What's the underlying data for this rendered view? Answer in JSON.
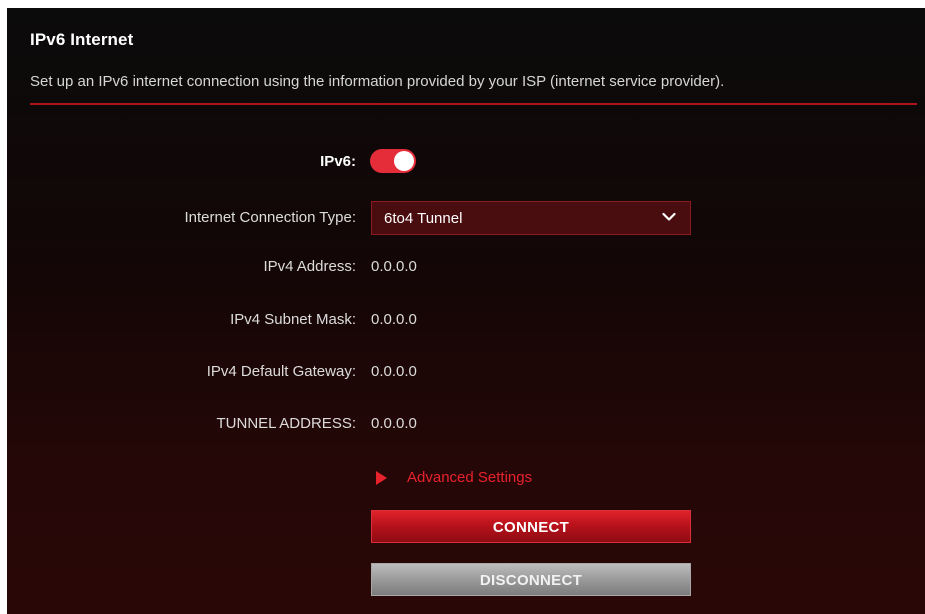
{
  "section": {
    "title": "IPv6 Internet",
    "description": "Set up an IPv6 internet connection using the information provided by your ISP (internet service provider)."
  },
  "colors": {
    "accent": "#e52d3a",
    "divider": "#b1131b",
    "link": "#e8222c"
  },
  "form": {
    "ipv6": {
      "label": "IPv6:",
      "enabled": true
    },
    "connection_type": {
      "label": "Internet Connection Type:",
      "value": "6to4 Tunnel",
      "icon": "chevron-down-icon"
    },
    "ipv4_address": {
      "label": "IPv4 Address:",
      "value": "0.0.0.0"
    },
    "ipv4_subnet_mask": {
      "label": "IPv4 Subnet Mask:",
      "value": "0.0.0.0"
    },
    "ipv4_default_gateway": {
      "label": "IPv4 Default Gateway:",
      "value": "0.0.0.0"
    },
    "tunnel_address": {
      "label": "TUNNEL ADDRESS:",
      "value": "0.0.0.0"
    }
  },
  "advanced": {
    "label": "Advanced Settings",
    "icon": "caret-right-icon"
  },
  "buttons": {
    "connect": "CONNECT",
    "disconnect": "DISCONNECT"
  }
}
